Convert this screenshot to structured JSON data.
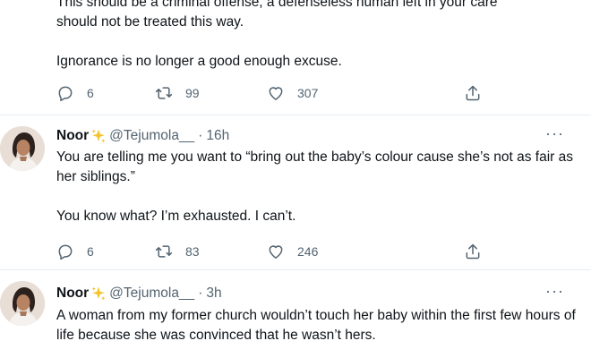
{
  "tweets": [
    {
      "text_lines": [
        "This should be a criminal offense, a defenseless human left in your care",
        "should not be treated this way."
      ],
      "text_line2": "Ignorance is no longer a good enough excuse.",
      "replies": "6",
      "retweets": "99",
      "likes": "307"
    },
    {
      "display_name": "Noor",
      "handle": "@Tejumola__",
      "dot": "·",
      "time": "16h",
      "more": "···",
      "text_p1": "You are telling me you want to “bring out the baby’s colour cause she’s not as fair as her siblings.”",
      "text_p2": "You know what? I’m exhausted. I can’t.",
      "replies": "6",
      "retweets": "83",
      "likes": "246"
    },
    {
      "display_name": "Noor",
      "handle": "@Tejumola__",
      "dot": "·",
      "time": "3h",
      "more": "···",
      "text_p1": "A woman from my former church wouldn’t touch her baby within the first few hours of life because she was convinced that he wasn’t hers."
    }
  ],
  "icons": {
    "reply": "reply-icon",
    "retweet": "retweet-icon",
    "like": "heart-icon",
    "share": "share-icon",
    "sparkle": "sparkles-emoji-icon"
  },
  "colors": {
    "secondary_text": "#536471",
    "divider": "#e6ecf0",
    "sparkle": "#f4c430"
  }
}
